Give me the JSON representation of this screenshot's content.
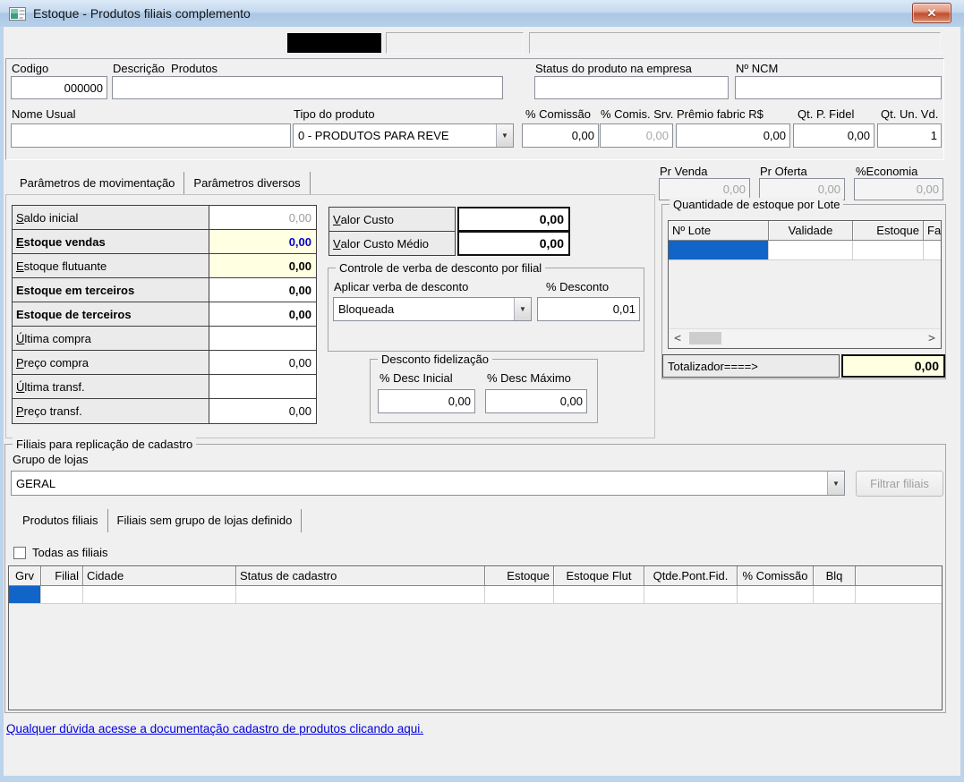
{
  "window": {
    "title": "Estoque - Produtos filiais complemento"
  },
  "icons": {
    "close": "✕",
    "dropdown": "▼",
    "scroll_left": "<",
    "scroll_right": ">"
  },
  "identification": {
    "codigo_label": "Codigo",
    "codigo_value": "000000",
    "descricao_label": "Descrição  Produtos",
    "descricao_value": "",
    "status_label": "Status do produto na empresa",
    "status_value": "",
    "ncm_label": "Nº NCM",
    "ncm_value": "",
    "nome_usual_label": "Nome Usual",
    "nome_usual_value": "",
    "tipo_label": "Tipo do produto",
    "tipo_value": "0 - PRODUTOS PARA REVE",
    "metrics": [
      {
        "label": "% Comissão",
        "value": "0,00"
      },
      {
        "label": "% Comis. Srv.",
        "value": "0,00"
      },
      {
        "label": "Prêmio fabric R$",
        "value": "0,00"
      },
      {
        "label": "Qt. P. Fidel",
        "value": "0,00"
      },
      {
        "label": "Qt. Un. Vd.",
        "value": "1"
      }
    ]
  },
  "prices": [
    {
      "label": "Pr Venda",
      "value": "0,00"
    },
    {
      "label": "Pr Oferta",
      "value": "0,00"
    },
    {
      "label": "%Economia",
      "value": "0,00"
    }
  ],
  "param_tabs": [
    {
      "label": "Parâmetros de movimentação"
    },
    {
      "label": "Parâmetros diversos"
    }
  ],
  "movimentacao": {
    "rows": [
      {
        "label": "Saldo inicial",
        "value": "0,00"
      },
      {
        "label": "Estoque vendas",
        "value": "0,00"
      },
      {
        "label": "Estoque flutuante",
        "value": "0,00"
      },
      {
        "label": "Estoque em terceiros",
        "value": "0,00"
      },
      {
        "label": "Estoque de terceiros",
        "value": "0,00"
      },
      {
        "label": "Última compra",
        "value": ""
      },
      {
        "label": "Preço compra",
        "value": "0,00"
      },
      {
        "label": "Última transf.",
        "value": ""
      },
      {
        "label": "Preço transf.",
        "value": "0,00"
      }
    ]
  },
  "custo": {
    "rows": [
      {
        "label": "Valor Custo",
        "value": "0,00"
      },
      {
        "label": "Valor Custo Médio",
        "value": "0,00"
      }
    ]
  },
  "verba": {
    "title": "Controle de verba de desconto por filial",
    "aplicar_label": "Aplicar verba de desconto",
    "aplicar_value": "Bloqueada",
    "desconto_label": "% Desconto",
    "desconto_value": "0,01"
  },
  "fidelizacao": {
    "title": "Desconto fidelização",
    "inicial_label": "% Desc Inicial",
    "inicial_value": "0,00",
    "maximo_label": "% Desc Máximo",
    "maximo_value": "0,00"
  },
  "lote": {
    "title": "Quantidade de estoque por Lote",
    "columns": [
      "Nº Lote",
      "Validade",
      "Estoque",
      "Fab"
    ],
    "totalizador_label": "Totalizador====>",
    "totalizador_value": "0,00"
  },
  "filiais": {
    "title": "Filiais para replicação de cadastro",
    "grupo_label": "Grupo de lojas",
    "grupo_value": "GERAL",
    "filtrar_button": "Filtrar filiais",
    "tabs": [
      {
        "label": "Produtos filiais"
      },
      {
        "label": "Filiais sem grupo de lojas definido"
      }
    ],
    "todas_label": "Todas as filiais",
    "columns": [
      "Grv",
      "Filial",
      "Cidade",
      "Status de cadastro",
      "Estoque",
      "Estoque Flut",
      "Qtde.Pont.Fid.",
      "% Comissão",
      "Blq"
    ]
  },
  "footer": {
    "help_link": "Qualquer dúvida acesse a documentação cadastro de produtos clicando aqui."
  },
  "colors": {
    "selection": "#1165c9",
    "highlight_field": "#ffffe1",
    "value_blue": "#0000cc",
    "link": "#0000dd",
    "titlebar": "#bcd3ec"
  }
}
